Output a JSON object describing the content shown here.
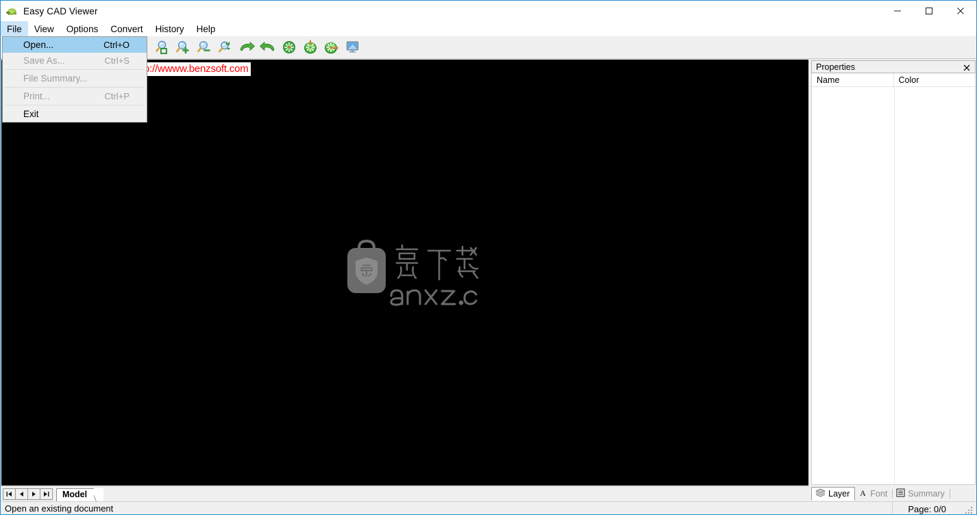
{
  "window": {
    "title": "Easy CAD Viewer",
    "icon": "turtle-app-icon",
    "controls": {
      "minimize": "minimize-icon",
      "maximize": "maximize-icon",
      "close": "close-icon"
    }
  },
  "menubar": {
    "items": [
      {
        "label": "File",
        "open": true
      },
      {
        "label": "View",
        "open": false
      },
      {
        "label": "Options",
        "open": false
      },
      {
        "label": "Convert",
        "open": false
      },
      {
        "label": "History",
        "open": false
      },
      {
        "label": "Help",
        "open": false
      }
    ]
  },
  "file_menu": {
    "items": [
      {
        "label": "Open...",
        "accel": "Ctrl+O",
        "enabled": true,
        "highlighted": true
      },
      {
        "label": "Save As...",
        "accel": "Ctrl+S",
        "enabled": false,
        "highlighted": false
      },
      {
        "label": "File Summary...",
        "accel": "",
        "enabled": false,
        "highlighted": false
      },
      {
        "label": "Print...",
        "accel": "Ctrl+P",
        "enabled": false,
        "highlighted": false
      },
      {
        "label": "Exit",
        "accel": "",
        "enabled": true,
        "highlighted": false
      }
    ]
  },
  "toolbar": {
    "buttons": [
      {
        "name": "zoom-window-icon",
        "tip": "Zoom Window"
      },
      {
        "name": "zoom-in-icon",
        "tip": "Zoom In"
      },
      {
        "name": "zoom-out-icon",
        "tip": "Zoom Out"
      },
      {
        "name": "zoom-select-icon",
        "tip": "Zoom Selected"
      },
      {
        "name": "redo-icon",
        "tip": "Redo"
      },
      {
        "name": "undo-icon",
        "tip": "Undo"
      },
      {
        "name": "zoom-extents-icon",
        "tip": "Zoom Extents"
      },
      {
        "name": "zoom-previous-icon",
        "tip": "Zoom Previous"
      },
      {
        "name": "zoom-next-icon",
        "tip": "Zoom Next"
      },
      {
        "name": "display-settings-icon",
        "tip": "Display"
      }
    ]
  },
  "canvas": {
    "background_color": "#000000",
    "url_watermark": "p://wwww.benzsoft.com",
    "url_watermark_color": "#ff0000",
    "center_watermark": {
      "logo_name": "anxz-bag-shield-logo",
      "cjk_text": "安下载",
      "domain_text": "anxz.com",
      "color": "#6b6b6b"
    }
  },
  "properties_panel": {
    "title": "Properties",
    "close_icon": "close-icon",
    "columns": [
      "Name",
      "Color"
    ],
    "rows": [],
    "tabs": [
      {
        "label": "Layer",
        "icon": "layers-icon",
        "active": true
      },
      {
        "label": "Font",
        "icon": "font-a-icon",
        "active": false
      },
      {
        "label": "Summary",
        "icon": "document-lines-icon",
        "active": false
      }
    ]
  },
  "sheet_bar": {
    "nav_buttons": [
      {
        "name": "first-sheet-button",
        "glyph": "|◀"
      },
      {
        "name": "previous-sheet-button",
        "glyph": "◀"
      },
      {
        "name": "next-sheet-button",
        "glyph": "▶"
      },
      {
        "name": "last-sheet-button",
        "glyph": "▶|"
      }
    ],
    "tabs": [
      {
        "label": "Model",
        "active": true
      }
    ]
  },
  "statusbar": {
    "message": "Open an existing document",
    "page_indicator": "Page: 0/0"
  }
}
